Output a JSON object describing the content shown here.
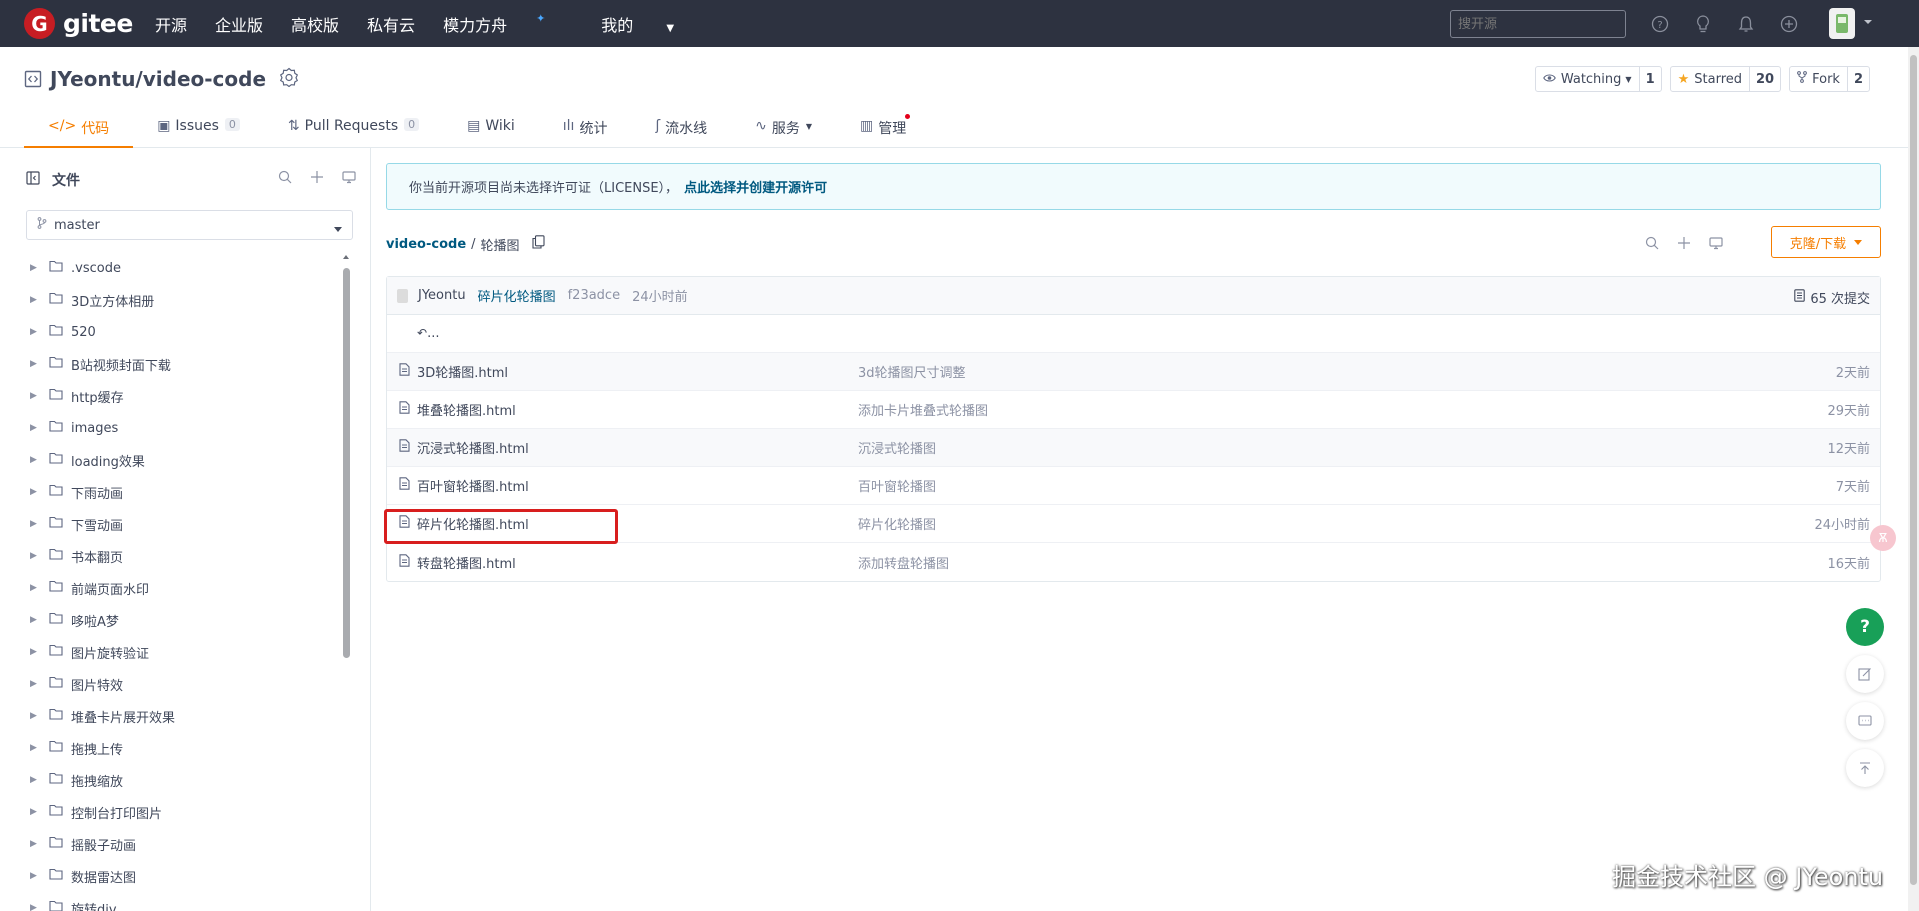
{
  "topbar": {
    "logo_letter": "G",
    "logo_text": "gitee",
    "nav": [
      "开源",
      "企业版",
      "高校版",
      "私有云",
      "模力方舟",
      "我的"
    ],
    "search_placeholder": "搜开源"
  },
  "repo": {
    "full_name": "JYeontu/video-code",
    "watch_label": "Watching",
    "watch_count": "1",
    "star_label": "Starred",
    "star_count": "20",
    "fork_label": "Fork",
    "fork_count": "2",
    "tabs": [
      {
        "label": "代码",
        "count": null
      },
      {
        "label": "Issues",
        "count": "0"
      },
      {
        "label": "Pull Requests",
        "count": "0"
      },
      {
        "label": "Wiki",
        "count": null
      },
      {
        "label": "统计",
        "count": null
      },
      {
        "label": "流水线",
        "count": null
      },
      {
        "label": "服务",
        "count": null
      },
      {
        "label": "管理",
        "count": null
      }
    ]
  },
  "sidebar": {
    "title": "文件",
    "branch": "master",
    "tree": [
      ".vscode",
      "3D立方体相册",
      "520",
      "B站视频封面下载",
      "http缓存",
      "images",
      "loading效果",
      "下雨动画",
      "下雪动画",
      "书本翻页",
      "前端页面水印",
      "哆啦A梦",
      "图片旋转验证",
      "图片特效",
      "堆叠卡片展开效果",
      "拖拽上传",
      "拖拽缩放",
      "控制台打印图片",
      "摇骰子动画",
      "数据雷达图",
      "旋转div"
    ]
  },
  "main": {
    "notice_text": "你当前开源项目尚未选择许可证（LICENSE），",
    "notice_link": "点此选择并创建开源许可",
    "path_root": "video-code",
    "path_sep": "/",
    "path_current": "轮播图",
    "clone_label": "克隆/下载",
    "commit": {
      "author": "JYeontu",
      "message": "碎片化轮播图",
      "sha": "f23adce",
      "time": "24小时前",
      "count": "65 次提交"
    },
    "back_label": "...",
    "files": [
      {
        "name": "3D轮播图.html",
        "commit": "3d轮播图尺寸调整",
        "time": "2天前"
      },
      {
        "name": "堆叠轮播图.html",
        "commit": "添加卡片堆叠式轮播图",
        "time": "29天前"
      },
      {
        "name": "沉浸式轮播图.html",
        "commit": "沉浸式轮播图",
        "time": "12天前"
      },
      {
        "name": "百叶窗轮播图.html",
        "commit": "百叶窗轮播图",
        "time": "7天前"
      },
      {
        "name": "碎片化轮播图.html",
        "commit": "碎片化轮播图",
        "time": "24小时前"
      },
      {
        "name": "转盘轮播图.html",
        "commit": "添加转盘轮播图",
        "time": "16天前"
      }
    ]
  },
  "float": {
    "help": "?"
  },
  "watermark": "掘金技术社区 @ JYeontu"
}
